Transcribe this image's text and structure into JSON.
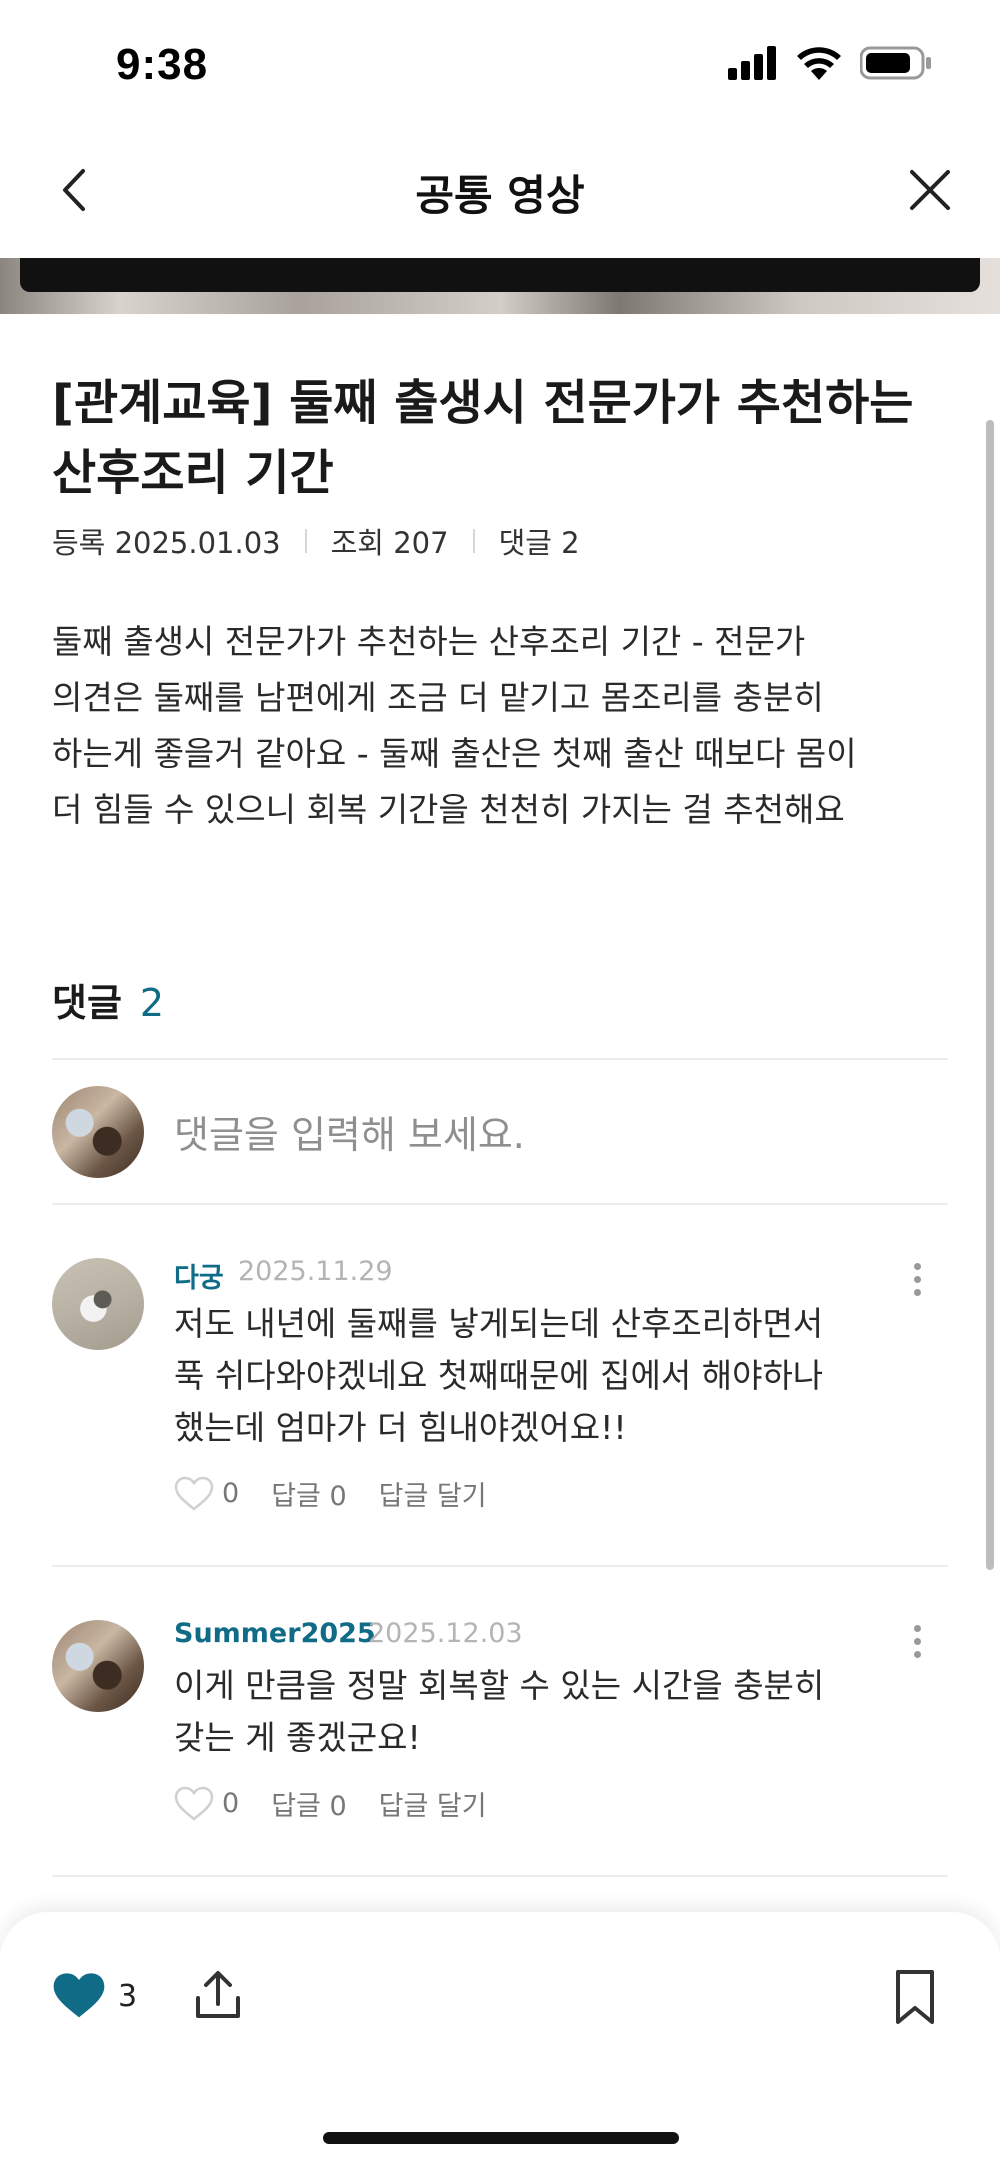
{
  "status_bar": {
    "time": "9:38"
  },
  "nav": {
    "title": "공통 영상"
  },
  "article": {
    "title_line1": "[관계교육] 둘째 출생시 전문가가 추천하는",
    "title_line2": "산후조리 기간",
    "date_label": "등록 2025.01.03",
    "views_label": "조회 207",
    "comments_label": "댓글 2",
    "body_lines": [
      "둘째 출생시 전문가가 추천하는 산후조리 기간 - 전문가",
      "의견은 둘째를 남편에게 조금 더 맡기고 몸조리를 충분히",
      "하는게 좋을거 같아요 - 둘째 출산은 첫째 출산 때보다 몸이",
      "더 힘들 수 있으니 회복 기간을 천천히 가지는 걸 추천해요"
    ]
  },
  "comments_section": {
    "header": "댓글",
    "count": "2",
    "input_placeholder": "댓글을 입력해 보세요."
  },
  "comments": [
    {
      "author": "다궁",
      "date": "2025.11.29",
      "lines": [
        "저도 내년에 둘째를 낳게되는데 산후조리하면서",
        "푹 쉬다와야겠네요 첫째때문에 집에서 해야하나",
        "했는데 엄마가 더 힘내야겠어요!!"
      ],
      "likes": "0",
      "replies_label": "답글 0",
      "reply_action": "답글 달기"
    },
    {
      "author": "Summer2025",
      "date": "2025.12.03",
      "lines": [
        "이게 만큼을 정말 회복할 수 있는 시간을 충분히",
        "갖는 게 좋겠군요!"
      ],
      "likes": "0",
      "replies_label": "답글 0",
      "reply_action": "답글 달기"
    }
  ],
  "bottom_bar": {
    "like_count": "3"
  },
  "colors": {
    "accent": "#0f6b86",
    "heart": "#0f6b86",
    "muted": "#8f8f8f"
  },
  "icons": [
    "back-chevron-icon",
    "close-icon",
    "heart-icon",
    "share-icon",
    "bookmark-icon",
    "more-vertical-icon",
    "heart-outline-icon",
    "signal-icon",
    "wifi-icon",
    "battery-icon"
  ]
}
